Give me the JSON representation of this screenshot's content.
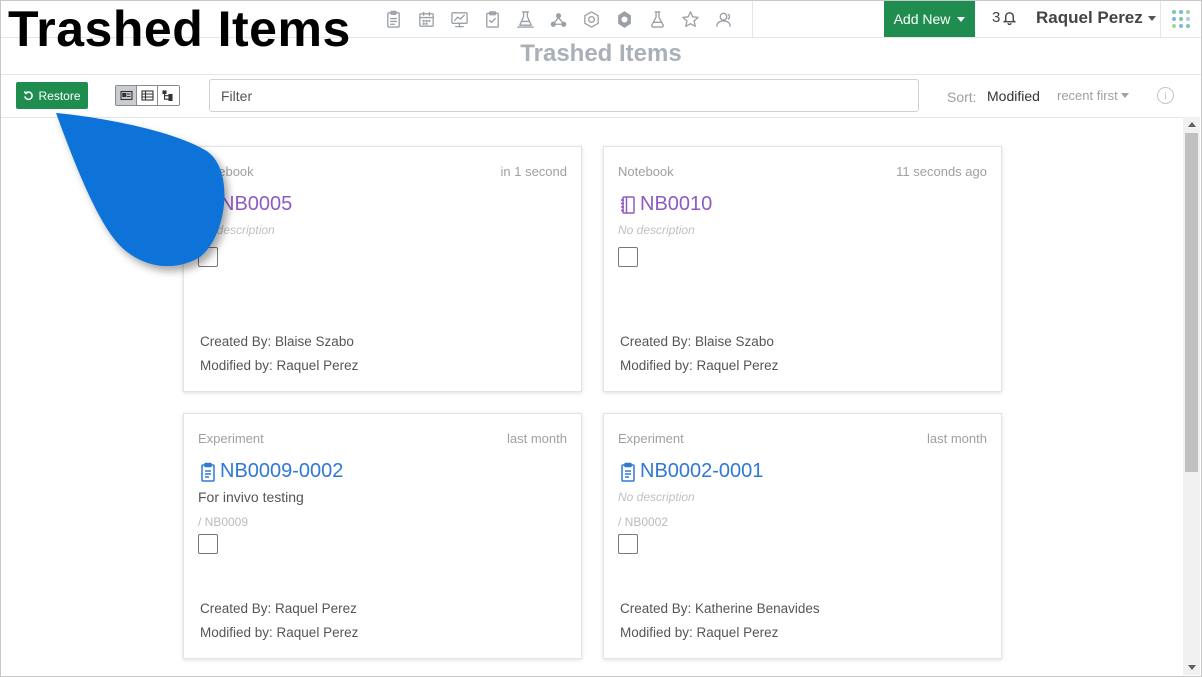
{
  "header": {
    "overlay_title": "Trashed Items",
    "nav_icons": [
      "experiment-icon",
      "calendar-icon",
      "presentation-icon",
      "clipboard-icon",
      "flask-stand-icon",
      "molecule-icon",
      "cell-icon",
      "tissue-icon",
      "beaker-icon",
      "star-icon",
      "users-icon"
    ],
    "add_new_label": "Add New",
    "notification_count": "3",
    "user_name": "Raquel Perez",
    "colors": {
      "brand_green": "#1e8d4f"
    }
  },
  "page": {
    "title": "Trashed Items"
  },
  "toolbar": {
    "restore_label": "Restore",
    "view_modes": [
      "card-view-icon",
      "table-view-icon",
      "tree-view-icon"
    ],
    "filter_placeholder": "Filter",
    "sort_label": "Sort:",
    "sort_field": "Modified",
    "sort_order": "recent first"
  },
  "cards": [
    {
      "type": "Notebook",
      "time": "in 1 second",
      "name": "NB0005",
      "icon": "notebook-icon",
      "color": "#8e5bc4",
      "description": "No description",
      "parent": "",
      "created_by": "Created By: Blaise Szabo",
      "modified_by": "Modified by: Raquel Perez"
    },
    {
      "type": "Notebook",
      "time": "11 seconds ago",
      "name": "NB0010",
      "icon": "notebook-icon",
      "color": "#8e5bc4",
      "description": "No description",
      "parent": "",
      "created_by": "Created By: Blaise Szabo",
      "modified_by": "Modified by: Raquel Perez"
    },
    {
      "type": "Experiment",
      "time": "last month",
      "name": "NB0009-0002",
      "icon": "experiment-icon",
      "color": "#2f78d6",
      "description": "For invivo testing",
      "parent": "/ NB0009",
      "created_by": "Created By: Raquel Perez",
      "modified_by": "Modified by: Raquel Perez"
    },
    {
      "type": "Experiment",
      "time": "last month",
      "name": "NB0002-0001",
      "icon": "experiment-icon",
      "color": "#2f78d6",
      "description": "No description",
      "parent": "/ NB0002",
      "created_by": "Created By: Katherine Benavides",
      "modified_by": "Modified by: Raquel Perez"
    }
  ]
}
